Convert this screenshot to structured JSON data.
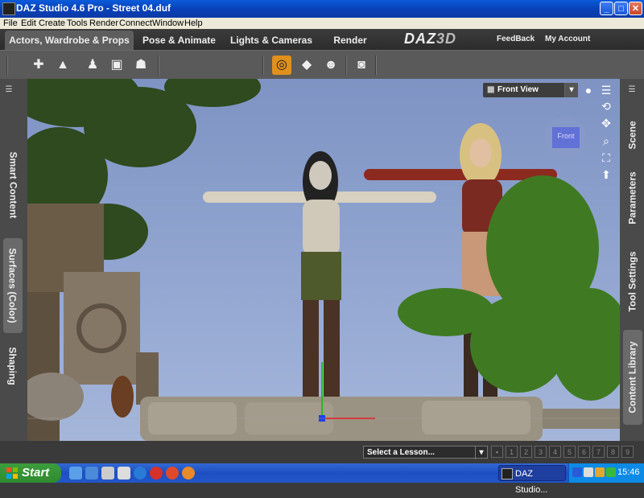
{
  "window": {
    "title": "DAZ Studio 4.6 Pro - Street 04.duf",
    "minimize_glyph": "_",
    "maximize_glyph": "□",
    "close_glyph": "✕"
  },
  "menu": [
    "File",
    "Edit",
    "Create",
    "Tools",
    "Render",
    "Connect",
    "Window",
    "Help"
  ],
  "tabs": [
    "Actors, Wardrobe & Props",
    "Pose & Animate",
    "Lights & Cameras",
    "Render"
  ],
  "brand": {
    "part1": "DAZ",
    "part2": "3D"
  },
  "top_links": {
    "feedback": "FeedBack",
    "account": "My Account"
  },
  "toolbar_icons": [
    "add-figure-icon",
    "add-environment-icon",
    "add-people-icon",
    "add-props-icon",
    "add-poses-icon",
    "surface-selection-icon",
    "node-selection-icon",
    "figure-tool-icon",
    "render-icon"
  ],
  "left_tabs": [
    "Smart Content",
    "Surfaces (Color)",
    "Shaping"
  ],
  "right_tabs": [
    "Scene",
    "Parameters",
    "Tool Settings",
    "Content Library"
  ],
  "viewport": {
    "view_name": "Front View",
    "cube_label": "Front"
  },
  "lesson": {
    "placeholder": "Select a Lesson...",
    "steps": [
      "1",
      "2",
      "3",
      "4",
      "5",
      "6",
      "7",
      "8",
      "9"
    ]
  },
  "taskbar": {
    "start_label": "Start",
    "task_label": "DAZ Studio...",
    "clock": "15:46"
  },
  "colors": {
    "active_tool": "#e0901c",
    "xp_blue": "#0a5bdc",
    "start_green": "#3c9e3c"
  }
}
